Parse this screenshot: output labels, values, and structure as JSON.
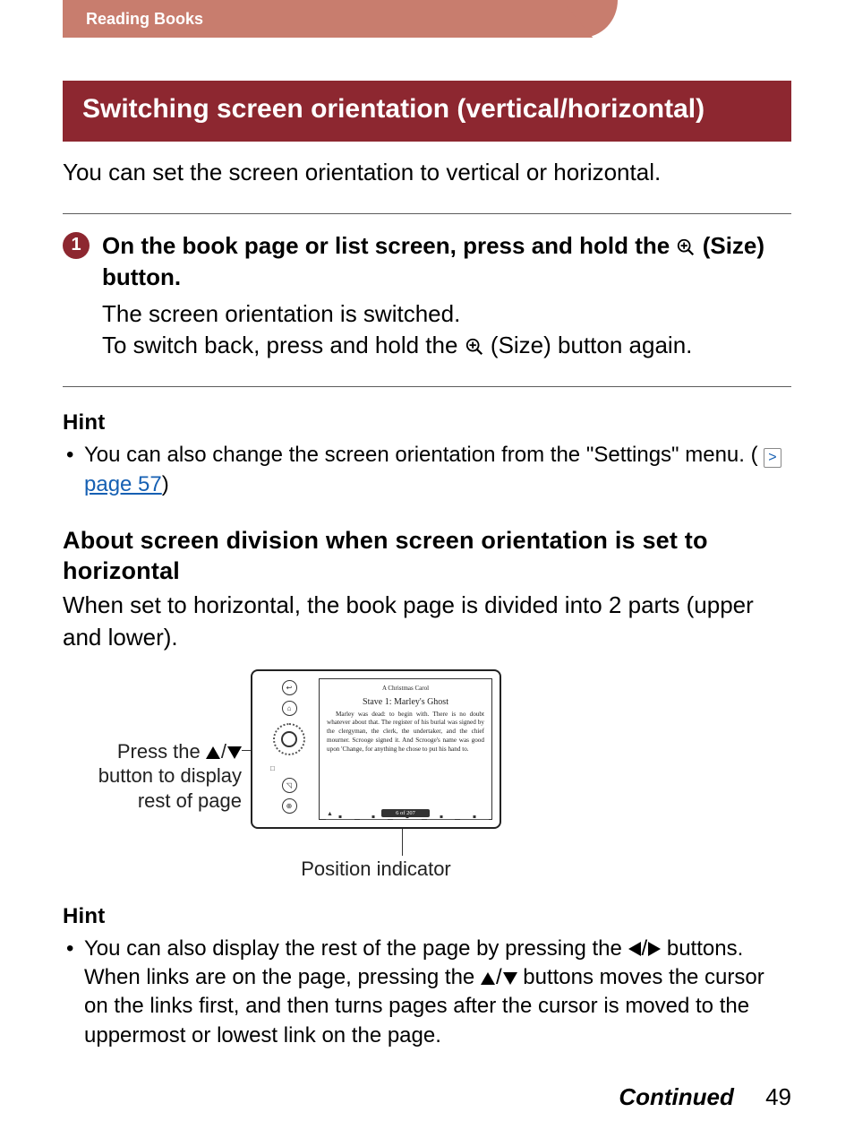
{
  "header": {
    "breadcrumb": "Reading Books"
  },
  "section": {
    "title": "Switching screen orientation (vertical/horizontal)",
    "intro": "You can set the screen orientation to vertical or horizontal."
  },
  "step1": {
    "number": "1",
    "heading_prefix": "On the book page or list screen, press and hold the ",
    "heading_suffix": " (Size) button.",
    "desc_line1": "The screen orientation is switched.",
    "desc_line2_prefix": "To switch back, press and hold the ",
    "desc_line2_suffix": " (Size) button again."
  },
  "hint1": {
    "label": "Hint",
    "text_prefix": "You can also change the screen orientation from the \"Settings\" menu. (",
    "link_icon": ">",
    "link_text": "page 57",
    "text_suffix": ")"
  },
  "subsection": {
    "heading": "About screen division when screen orientation is set to horizontal",
    "para": "When set to horizontal, the book page is divided into 2 parts (upper and lower)."
  },
  "device": {
    "callout_left_l1": "Press the ",
    "callout_left_l2": "button to display",
    "callout_left_l3": "rest of page",
    "callout_bottom": "Position indicator",
    "screen": {
      "book_title": "A Christmas Carol",
      "chapter": "Stave 1: Marley's Ghost",
      "body": "Marley was dead: to begin with. There is no doubt whatever about that. The register of his burial was signed by the clergyman, the clerk, the undertaker, and the chief mourner. Scrooge signed it. And Scrooge's name was good upon 'Change, for anything he chose to put his hand to.",
      "pager": "6 of 207"
    }
  },
  "hint2": {
    "label": "Hint",
    "text_a": "You can also display the rest of the page by pressing the ",
    "text_b": " buttons. When links are on the page, pressing the ",
    "text_c": " buttons moves the cursor on the links first, and then turns pages after the cursor is moved to the uppermost or lowest link on the page."
  },
  "footer": {
    "continued": "Continued",
    "page_number": "49"
  }
}
